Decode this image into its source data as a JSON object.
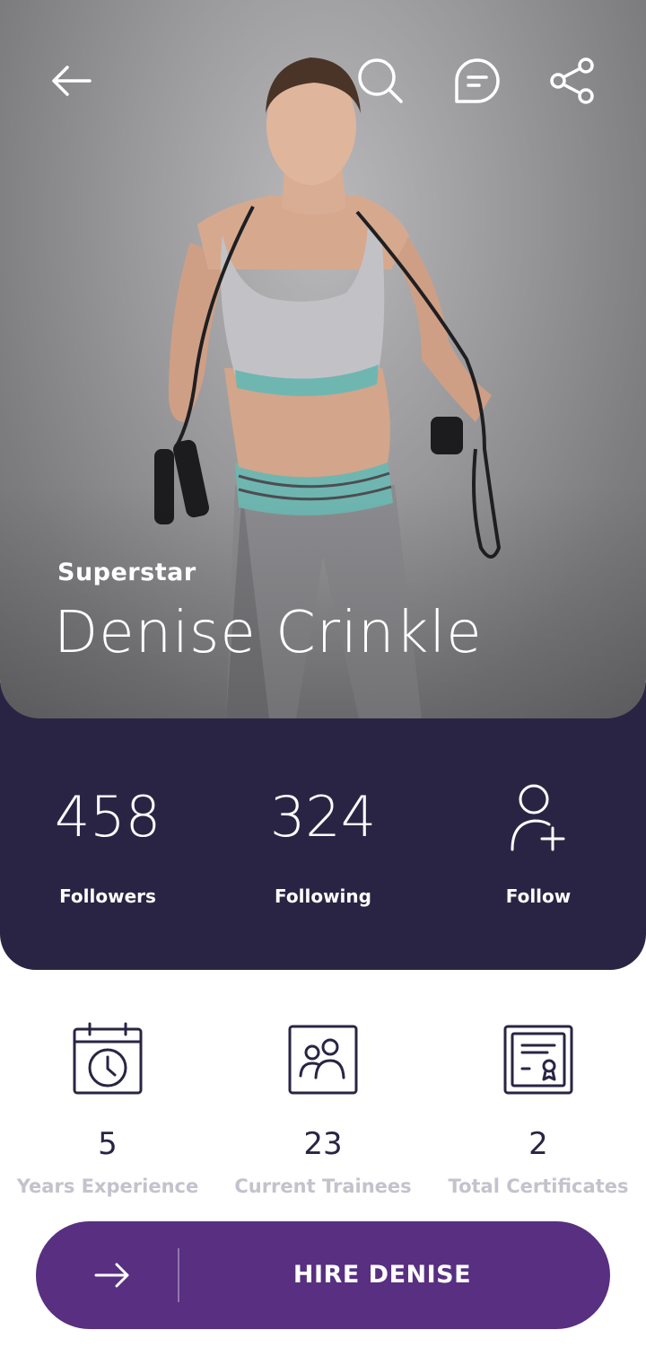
{
  "hero": {
    "subtitle": "Superstar",
    "name": "Denise Crinkle"
  },
  "top_bar": {
    "icons": [
      "arrow-left-icon",
      "search-icon",
      "chat-icon",
      "share-icon"
    ]
  },
  "stats": {
    "followers": {
      "value": "458",
      "label": "Followers"
    },
    "following": {
      "value": "324",
      "label": "Following"
    },
    "follow": {
      "label": "Follow",
      "icon": "add-user-icon"
    }
  },
  "info": [
    {
      "icon": "calendar-clock-icon",
      "value": "5",
      "label": "Years Experience"
    },
    {
      "icon": "trainees-icon",
      "value": "23",
      "label": "Current Trainees"
    },
    {
      "icon": "certificate-icon",
      "value": "2",
      "label": "Total Certificates"
    }
  ],
  "cta": {
    "label": "HIRE DENISE",
    "icon": "arrow-right-icon"
  },
  "colors": {
    "panel": "#2a2444",
    "accent": "#582f81",
    "muted_text": "#c4c2cc",
    "dark_text": "#2a2444"
  }
}
